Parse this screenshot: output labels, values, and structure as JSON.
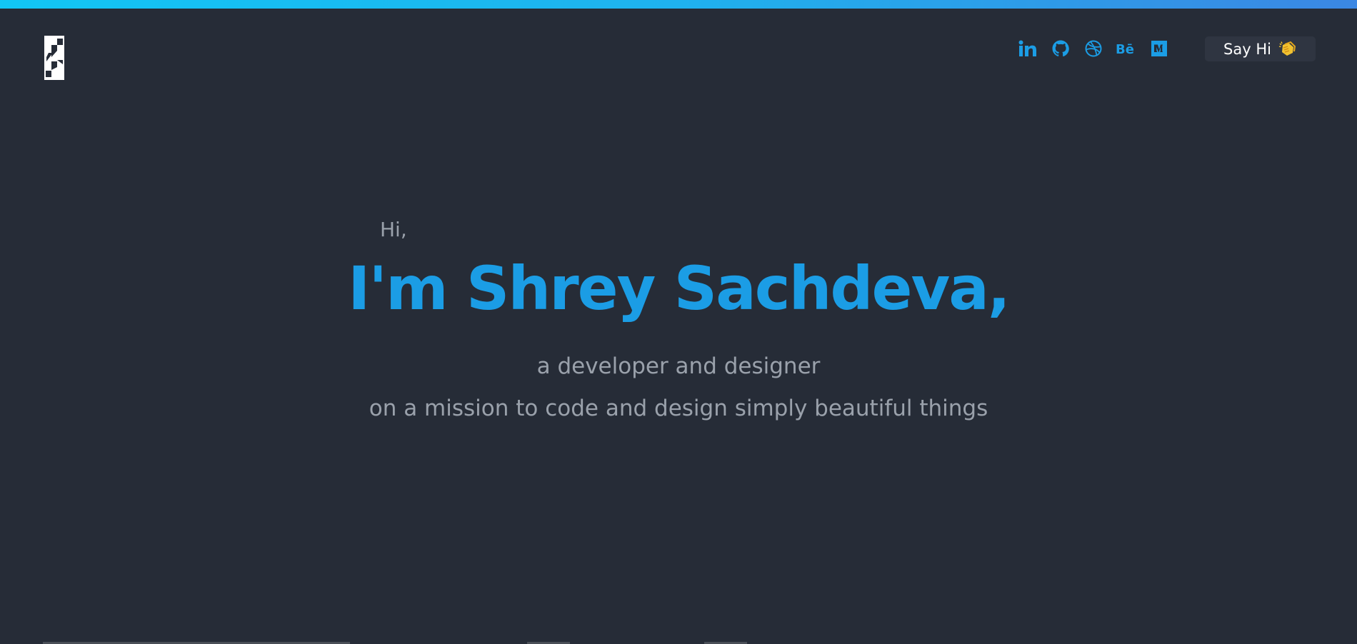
{
  "theme": {
    "background": "#262c37",
    "accent": "#1b9de5",
    "muted_text": "#9aa1ab",
    "gradient_start": "#12c6f5",
    "gradient_end": "#3b87e3"
  },
  "header": {
    "logo_icon": "s-monogram-logo",
    "social_links": [
      {
        "name": "linkedin",
        "icon": "linkedin-icon"
      },
      {
        "name": "github",
        "icon": "github-icon"
      },
      {
        "name": "dribbble",
        "icon": "dribbble-icon"
      },
      {
        "name": "behance",
        "icon": "behance-icon"
      },
      {
        "name": "medium",
        "icon": "medium-icon"
      }
    ],
    "cta_label": "Say Hi",
    "cta_icon": "clapping-hands-icon"
  },
  "hero": {
    "greeting": "Hi,",
    "headline": "I'm Shrey Sachdeva,",
    "tagline_1": "a developer and designer",
    "tagline_2": "on a mission to code and design simply beautiful things"
  }
}
